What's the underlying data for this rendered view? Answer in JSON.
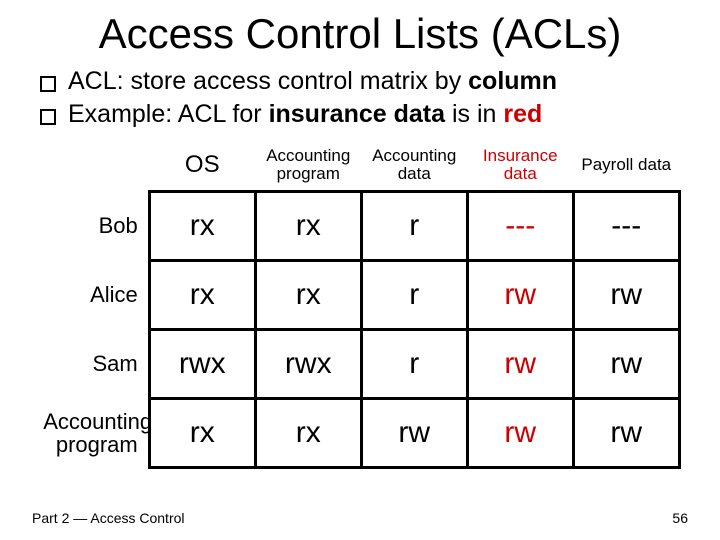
{
  "title": "Access Control Lists (ACLs)",
  "bullets": {
    "b1_pre": "ACL: store access control matrix by ",
    "b1_bold": "column",
    "b2_pre": "Example: ACL for ",
    "b2_bold1": "insurance data",
    "b2_mid": " is in ",
    "b2_bold2": "red"
  },
  "headers": {
    "subj_blank": "",
    "os": "OS",
    "acct_prog": "Accounting program",
    "acct_data": "Accounting data",
    "ins_data": "Insurance data",
    "pay_data": "Payroll data"
  },
  "subjects": {
    "bob": "Bob",
    "alice": "Alice",
    "sam": "Sam",
    "acct_prog": "Accounting program"
  },
  "cells": {
    "bob": {
      "os": "rx",
      "aprog": "rx",
      "adata": "r",
      "ins": "---",
      "pay": "---"
    },
    "alice": {
      "os": "rx",
      "aprog": "rx",
      "adata": "r",
      "ins": "rw",
      "pay": "rw"
    },
    "sam": {
      "os": "rwx",
      "aprog": "rwx",
      "adata": "r",
      "ins": "rw",
      "pay": "rw"
    },
    "ap": {
      "os": "rx",
      "aprog": "rx",
      "adata": "rw",
      "ins": "rw",
      "pay": "rw"
    }
  },
  "footer": {
    "left": "Part 2 — Access Control",
    "right": "56"
  },
  "chart_data": {
    "type": "table",
    "title": "Access Control Matrix (ACL example)",
    "columns": [
      "OS",
      "Accounting program",
      "Accounting data",
      "Insurance data",
      "Payroll data"
    ],
    "rows": [
      "Bob",
      "Alice",
      "Sam",
      "Accounting program"
    ],
    "values": [
      [
        "rx",
        "rx",
        "r",
        "---",
        "---"
      ],
      [
        "rx",
        "rx",
        "r",
        "rw",
        "rw"
      ],
      [
        "rwx",
        "rwx",
        "r",
        "rw",
        "rw"
      ],
      [
        "rx",
        "rx",
        "rw",
        "rw",
        "rw"
      ]
    ],
    "highlight_column": "Insurance data",
    "highlight_color": "#cc0000"
  }
}
